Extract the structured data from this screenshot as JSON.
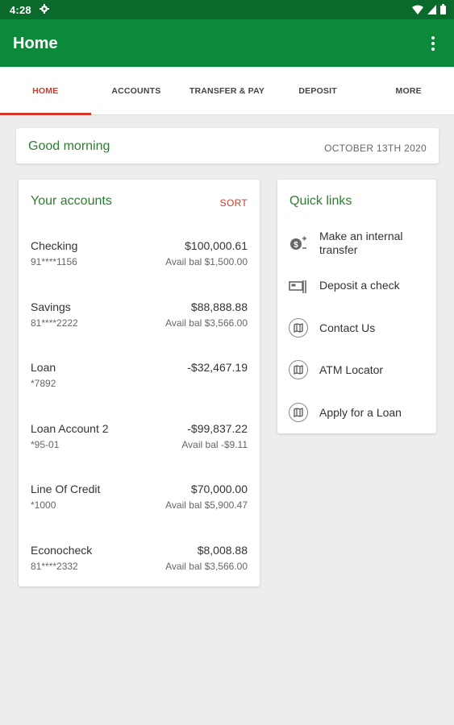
{
  "status_bar": {
    "time": "4:28"
  },
  "app_bar": {
    "title": "Home"
  },
  "tabs": [
    {
      "label": "HOME",
      "active": true
    },
    {
      "label": "ACCOUNTS"
    },
    {
      "label": "TRANSFER & PAY"
    },
    {
      "label": "DEPOSIT"
    },
    {
      "label": "MORE"
    }
  ],
  "greeting": {
    "text": "Good morning",
    "date": "OCTOBER 13TH 2020"
  },
  "accounts": {
    "title": "Your accounts",
    "sort_label": "SORT",
    "items": [
      {
        "name": "Checking",
        "number": "91****1156",
        "balance": "$100,000.61",
        "available": "Avail bal $1,500.00"
      },
      {
        "name": "Savings",
        "number": "81****2222",
        "balance": "$88,888.88",
        "available": "Avail bal $3,566.00"
      },
      {
        "name": "Loan",
        "number": "*7892",
        "balance": "-$32,467.19",
        "available": ""
      },
      {
        "name": "Loan Account 2",
        "number": "*95-01",
        "balance": "-$99,837.22",
        "available": "Avail bal -$9.11"
      },
      {
        "name": "Line Of Credit",
        "number": "*1000",
        "balance": "$70,000.00",
        "available": "Avail bal $5,900.47"
      },
      {
        "name": "Econocheck",
        "number": "81****2332",
        "balance": "$8,008.88",
        "available": "Avail bal $3,566.00"
      }
    ]
  },
  "quick_links": {
    "title": "Quick links",
    "items": [
      {
        "label": "Make an internal transfer",
        "icon": "transfer-icon"
      },
      {
        "label": "Deposit a check",
        "icon": "check-deposit-icon"
      },
      {
        "label": "Contact Us",
        "icon": "map-icon"
      },
      {
        "label": "ATM Locator",
        "icon": "map-icon"
      },
      {
        "label": "Apply for a Loan",
        "icon": "map-icon"
      }
    ]
  },
  "colors": {
    "status_bar": "#0a6a2c",
    "app_bar": "#0b8a3a",
    "accent_red": "#d0392b",
    "green_text": "#2f7d32"
  }
}
